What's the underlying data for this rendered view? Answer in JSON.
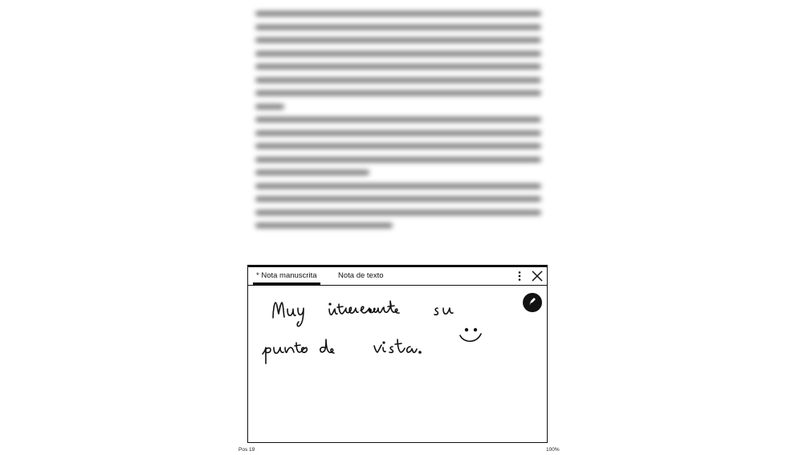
{
  "note": {
    "tabs": [
      {
        "label": "* Nota manuscrita",
        "active": true
      },
      {
        "label": "Nota de texto",
        "active": false
      }
    ],
    "menu_icon": "kebab-menu-icon",
    "close_icon": "close-icon",
    "pen_icon": "pen-icon",
    "handwritten_content": "Muy interesante su punto de vista. :)"
  },
  "footer": {
    "location": "Pos 19",
    "progress": "100%"
  }
}
